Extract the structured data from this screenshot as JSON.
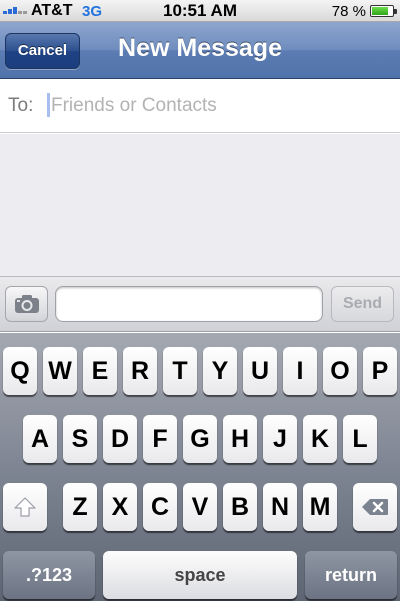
{
  "status_bar": {
    "carrier": "AT&T",
    "network": "3G",
    "time": "10:51 AM",
    "battery_percent": "78 %",
    "battery_level": 0.78,
    "signal_icon": "signal-bars-icon",
    "battery_icon": "battery-icon"
  },
  "nav": {
    "cancel_label": "Cancel",
    "title": "New Message"
  },
  "to_field": {
    "label": "To:",
    "value": "",
    "placeholder": "Friends or Contacts"
  },
  "compose": {
    "camera_icon": "camera-icon",
    "message_value": "",
    "send_label": "Send"
  },
  "keyboard": {
    "row1": [
      "Q",
      "W",
      "E",
      "R",
      "T",
      "Y",
      "U",
      "I",
      "O",
      "P"
    ],
    "row2": [
      "A",
      "S",
      "D",
      "F",
      "G",
      "H",
      "J",
      "K",
      "L"
    ],
    "row3": [
      "Z",
      "X",
      "C",
      "V",
      "B",
      "N",
      "M"
    ],
    "shift_icon": "shift-arrow-icon",
    "delete_icon": "backspace-icon",
    "numbers_label": ".?123",
    "space_label": "space",
    "return_label": "return"
  },
  "colors": {
    "nav_bar": "#5c7db3",
    "cancel_button": "#2c4f8e",
    "network_label": "#2474e0",
    "battery_fill": "#30a51a",
    "conversation_bg": "#ededf1"
  }
}
